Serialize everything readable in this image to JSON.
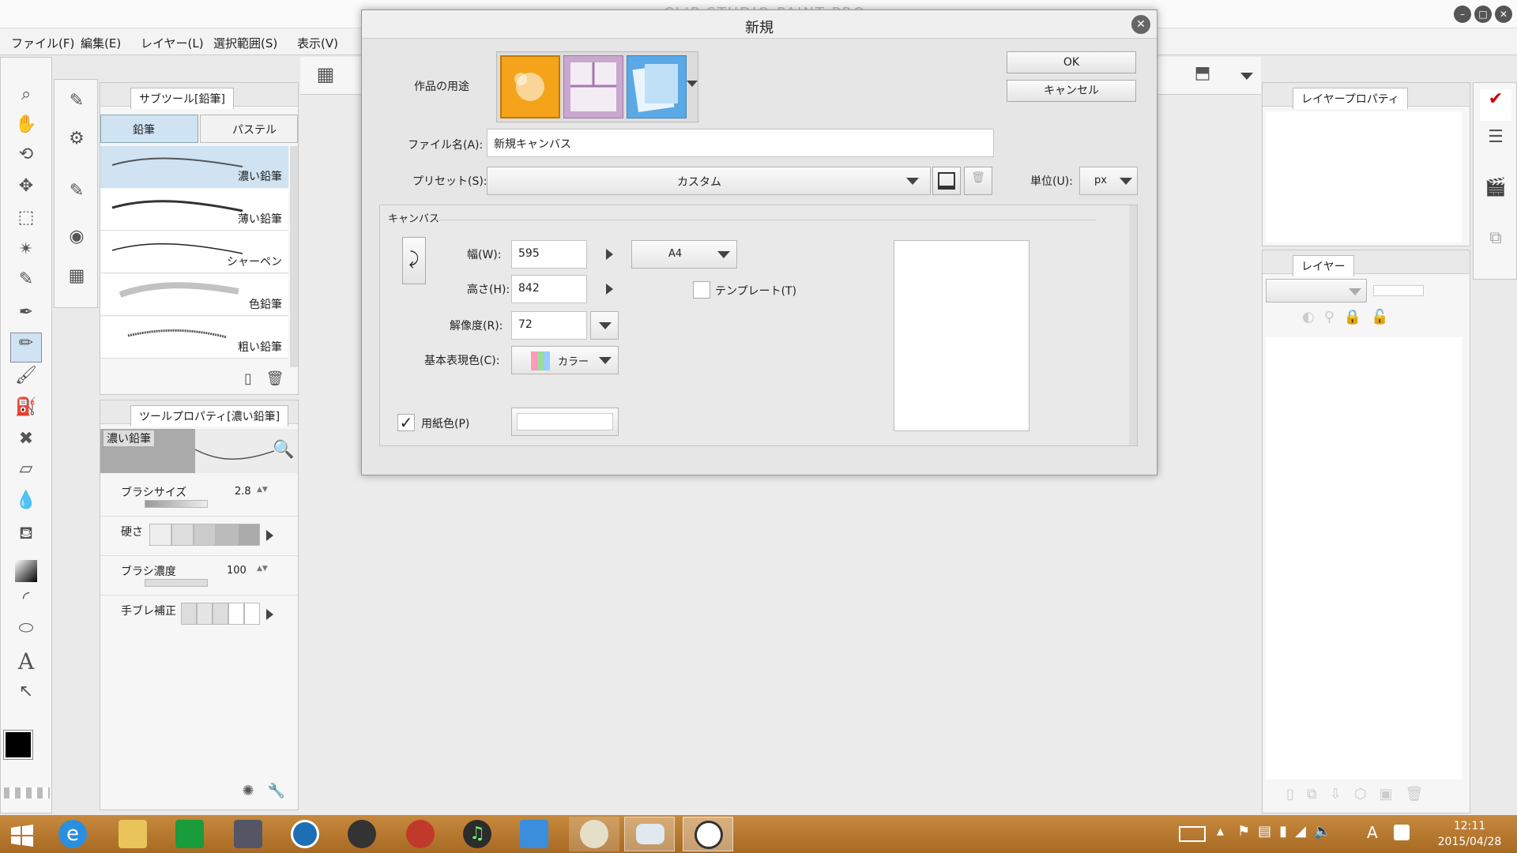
{
  "app": {
    "title": "CLIP STUDIO PAINT PRO"
  },
  "menu": [
    "ファイル(F)",
    "編集(E)",
    "レイヤー(L)",
    "選択範囲(S)",
    "表示(V)"
  ],
  "subtool_panel": {
    "tab_label": "サブツール[鉛筆]",
    "tabs": [
      "鉛筆",
      "パステル"
    ],
    "brushes": [
      "濃い鉛筆",
      "薄い鉛筆",
      "シャーペン",
      "色鉛筆",
      "粗い鉛筆"
    ]
  },
  "tool_property_panel": {
    "tab_label": "ツールプロパティ[濃い鉛筆]",
    "preview_label": "濃い鉛筆",
    "brush_size": {
      "label": "ブラシサイズ",
      "value": "2.8"
    },
    "hardness": {
      "label": "硬さ"
    },
    "brush_density": {
      "label": "ブラシ濃度",
      "value": "100"
    },
    "stabilization": {
      "label": "手ブレ補正"
    }
  },
  "layer_property_panel": {
    "tab_label": "レイヤープロパティ"
  },
  "layer_panel": {
    "tab_label": "レイヤー"
  },
  "dialog": {
    "title": "新規",
    "purpose_label": "作品の用途",
    "ok_label": "OK",
    "cancel_label": "キャンセル",
    "file_name_label": "ファイル名(A):",
    "file_name_value": "新規キャンバス",
    "preset_label": "プリセット(S):",
    "preset_value": "カスタム",
    "unit_label": "単位(U):",
    "unit_value": "px",
    "canvas_group_label": "キャンバス",
    "width_label": "幅(W):",
    "width_value": "595",
    "height_label": "高さ(H):",
    "height_value": "842",
    "resolution_label": "解像度(R):",
    "resolution_value": "72",
    "color_mode_label": "基本表現色(C):",
    "color_mode_value": "カラー",
    "paper_size_value": "A4",
    "template_label": "テンプレート(T)",
    "paper_color_label": "用紙色(P)",
    "paper_color_checked": true
  },
  "clock": {
    "time": "12:11",
    "date": "2015/04/28"
  },
  "colors": {
    "accent": "#f4a31a",
    "taskbar": "#b87a30",
    "brush_selected": "#cfe3f3",
    "main_color": "#000000"
  }
}
